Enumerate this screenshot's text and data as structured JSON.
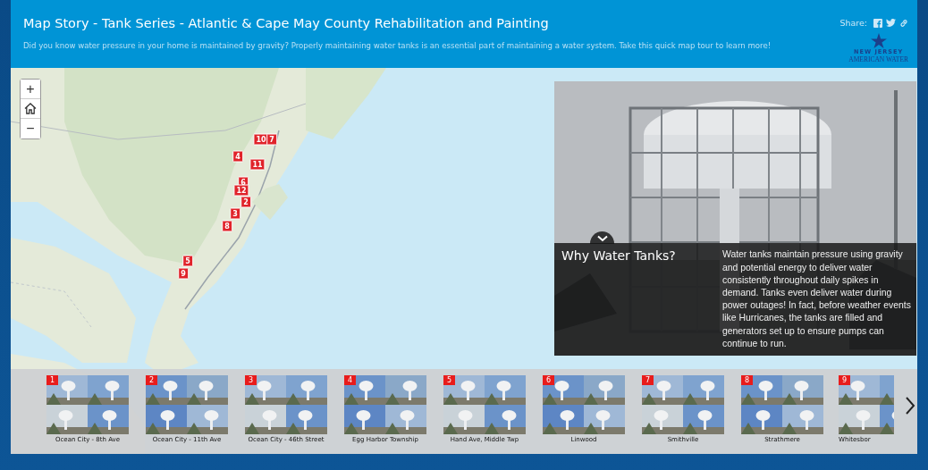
{
  "header": {
    "title": "Map Story - Tank Series - Atlantic & Cape May County Rehabilitation and Painting",
    "subtitle": "Did you know water pressure in your home is maintained by gravity? Properly maintaining water tanks is an essential part of maintaining a water system. Take this quick map tour to learn more!",
    "share_label": "Share:",
    "logo": {
      "line_1": "NEW JERSEY",
      "line_2": "AMERICAN WATER"
    }
  },
  "map": {
    "controls": [
      "+",
      "−"
    ],
    "markers": [
      {
        "label": "10"
      },
      {
        "label": "7"
      },
      {
        "label": "4"
      },
      {
        "label": "11"
      },
      {
        "label": "6"
      },
      {
        "label": "12"
      },
      {
        "label": "2"
      },
      {
        "label": "3"
      },
      {
        "label": "8"
      },
      {
        "label": "5"
      },
      {
        "label": "9"
      }
    ]
  },
  "story": {
    "title": "Why Water Tanks?",
    "text": "Water tanks maintain pressure using gravity and potential energy to deliver water consistently throughout daily spikes in demand. Tanks even deliver water during power outages! In fact, before weather events like Hurricanes, the tanks are filled and generators set up to ensure pumps can continue to run.",
    "expanded": true
  },
  "thumbnails": [
    {
      "number": "1",
      "caption": "Ocean City - 8th Ave"
    },
    {
      "number": "2",
      "caption": "Ocean City - 11th Ave"
    },
    {
      "number": "3",
      "caption": "Ocean City - 46th Street"
    },
    {
      "number": "4",
      "caption": "Egg Harbor Township"
    },
    {
      "number": "5",
      "caption": "Hand Ave, Middle Twp"
    },
    {
      "number": "6",
      "caption": "Linwood"
    },
    {
      "number": "7",
      "caption": "Smithville"
    },
    {
      "number": "8",
      "caption": "Strathmere"
    },
    {
      "number": "9",
      "caption": "Whitesbor"
    }
  ]
}
